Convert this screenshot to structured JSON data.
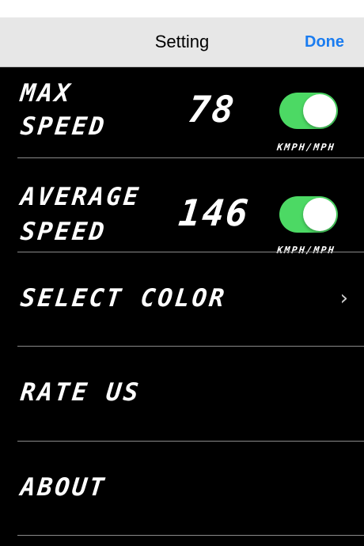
{
  "navbar": {
    "title": "Setting",
    "done_label": "Done"
  },
  "max_speed": {
    "label_line1": "MAX",
    "label_line2": "SPEED",
    "value": "78",
    "unit_label": "KMPH/MPH",
    "toggle_on": true
  },
  "average_speed": {
    "label_line1": "AVERAGE",
    "label_line2": "SPEED",
    "value": "146",
    "unit_label": "KMPH/MPH",
    "toggle_on": true
  },
  "menu": {
    "select_color": "SELECT COLOR",
    "rate_us": "RATE US",
    "about": "ABOUT"
  },
  "colors": {
    "background": "#000000",
    "navbar": "#e7e7e7",
    "accent": "#1a7cf0",
    "toggle_on": "#4cd964"
  },
  "icons": {
    "chevron": "chevron-right-icon"
  }
}
